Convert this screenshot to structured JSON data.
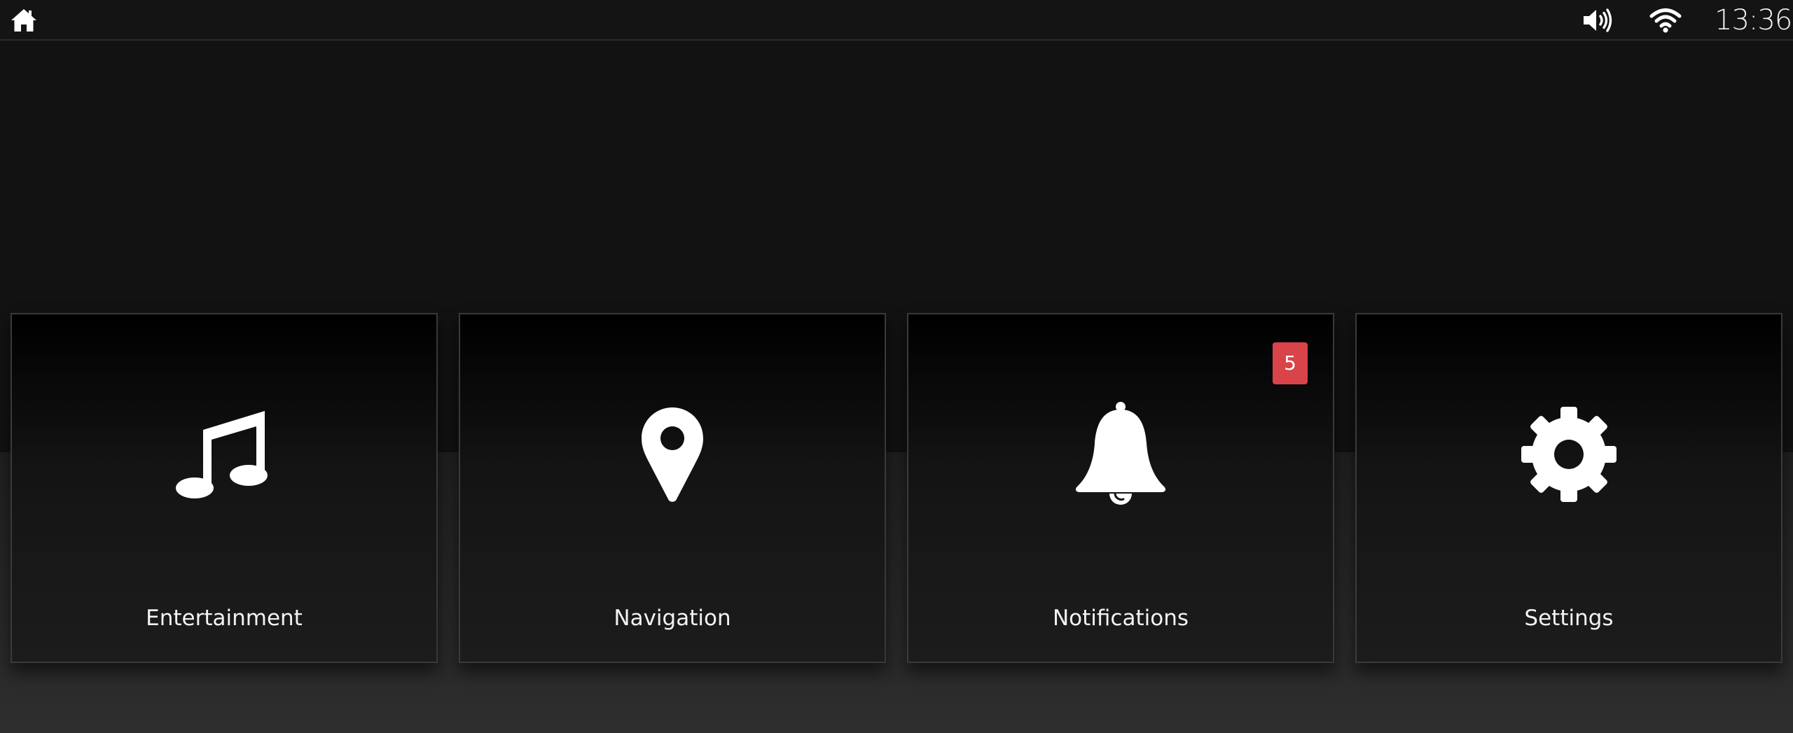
{
  "statusbar": {
    "home_icon": "home-icon",
    "volume_icon": "volume-icon",
    "wifi_icon": "wifi-icon",
    "time": "13:36"
  },
  "tiles": [
    {
      "label": "Entertainment",
      "icon": "music-note-icon"
    },
    {
      "label": "Navigation",
      "icon": "map-pin-icon"
    },
    {
      "label": "Notifications",
      "icon": "bell-icon",
      "badge": "5"
    },
    {
      "label": "Settings",
      "icon": "gear-icon"
    }
  ],
  "colors": {
    "background": "#121212",
    "statusbar": "#141414",
    "badge": "#d9434a",
    "text": "#f2f2f2"
  }
}
